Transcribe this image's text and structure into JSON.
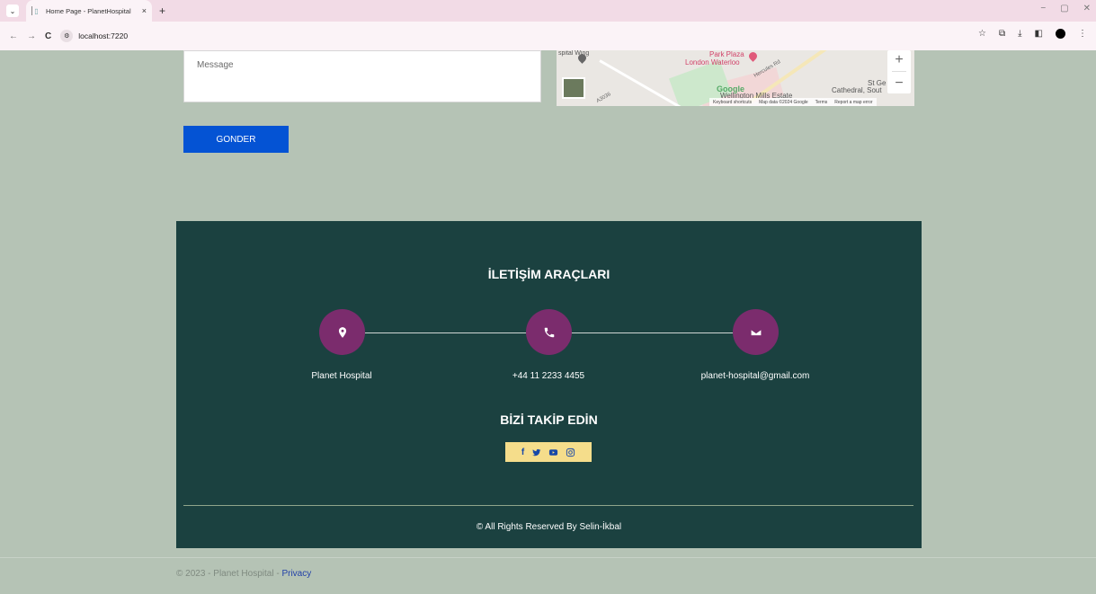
{
  "browser": {
    "tab_title": "Home Page - PlanetHospital",
    "tab_close": "×",
    "new_tab": "+",
    "url": "localhost:7220",
    "min": "−",
    "restore": "▢",
    "close": "✕"
  },
  "form": {
    "message_placeholder": "Message",
    "submit_label": "GONDER"
  },
  "map": {
    "label_park_plaza": "Park Plaza",
    "label_london_waterloo": "London Waterloo",
    "label_spital_wing": "spital\nWing",
    "label_st_george": "St Ge",
    "label_cathedral": "Cathedral, Sout",
    "label_wellington": "Wellington Mills Estate",
    "label_hercules": "Hercules Rd",
    "label_a3036": "A3036",
    "google": "Google",
    "zoom_in": "+",
    "zoom_out": "−",
    "foot_shortcuts": "Keyboard shortcuts",
    "foot_data": "Map data ©2024 Google",
    "foot_terms": "Terms",
    "foot_report": "Report a map error"
  },
  "footer": {
    "contact_title": "İLETİŞİM ARAÇLARI",
    "address_label": "Planet Hospital",
    "phone_label": "+44 11 2233 4455",
    "email_label": "planet-hospital@gmail.com",
    "follow_title": "BİZİ TAKİP EDİN",
    "copyright": "© All Rights Reserved By Selin-İkbal"
  },
  "page_footer": {
    "text": "© 2023 - Planet Hospital - ",
    "privacy_link": "Privacy"
  },
  "colors": {
    "page_bg": "#b5c3b5",
    "footer_bg": "#1b4140",
    "circle_bg": "#7b2c6d",
    "button_bg": "#0453d4",
    "social_bg": "#f5dd8b"
  }
}
